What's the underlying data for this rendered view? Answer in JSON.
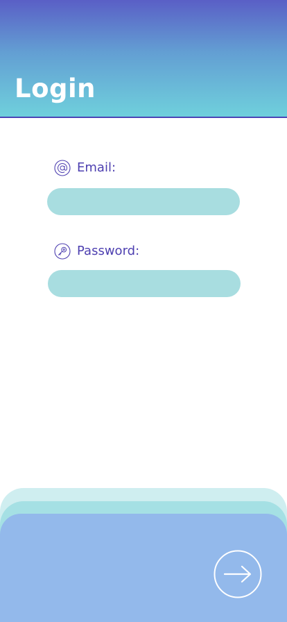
{
  "header": {
    "title": "Login"
  },
  "form": {
    "email": {
      "label": "Email:",
      "value": "",
      "icon": "at-sign-icon"
    },
    "password": {
      "label": "Password:",
      "value": "",
      "icon": "key-icon"
    }
  },
  "submit": {
    "icon": "arrow-right-icon"
  },
  "colors": {
    "header_top": "#5a5fc6",
    "header_bottom": "#6fd0dc",
    "accent": "#4d3fb0",
    "input_fill": "#a8dde0",
    "bottom_panel": "#93b9eb"
  }
}
